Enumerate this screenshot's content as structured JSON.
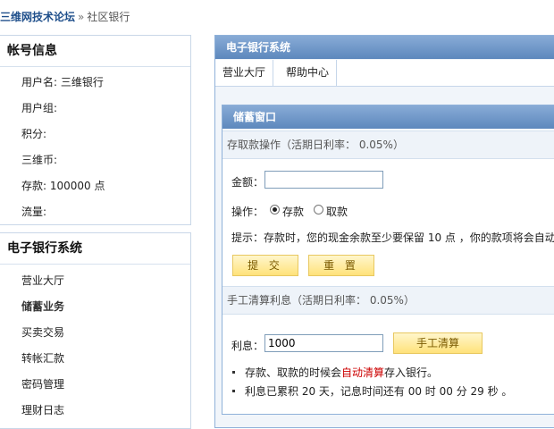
{
  "breadcrumb": {
    "site": "三维网技术论坛",
    "sep": "»",
    "current": "社区银行"
  },
  "account": {
    "title": "帐号信息",
    "rows": [
      {
        "label": "用户名: ",
        "value": "三维银行"
      },
      {
        "label": "用户组:",
        "value": ""
      },
      {
        "label": "积分:",
        "value": ""
      },
      {
        "label": "三维币:",
        "value": ""
      },
      {
        "label": "存款: ",
        "value": "100000 点"
      },
      {
        "label": "流量:",
        "value": ""
      }
    ]
  },
  "bank_nav": {
    "title": "电子银行系统",
    "items": [
      "营业大厅",
      "储蓄业务",
      "买卖交易",
      "转帐汇款",
      "密码管理",
      "理财日志"
    ],
    "active_index": 1
  },
  "main": {
    "title": "电子银行系统",
    "tabs": [
      "营业大厅",
      "帮助中心"
    ],
    "window_title": "储蓄窗口",
    "deposit_section": {
      "title": "存取款操作",
      "rate_text": "（活期日利率：  0.05%）"
    },
    "amount_label": "金额：",
    "amount_value": "",
    "operation_label": "操作：",
    "op_deposit": "存款",
    "op_withdraw": "取款",
    "hint": "提示：存款时，您的现金余款至少要保留  10 点  ，你的款项将会自动",
    "submit_label": "提 交",
    "reset_label": "重 置",
    "interest_section": {
      "title": "手工清算利息",
      "rate_text": "（活期日利率：  0.05%）"
    },
    "interest_label": "利息：",
    "interest_value": "1000",
    "settle_label": "手工清算",
    "note1_a": "存款、取款的时候会",
    "note1_link": "自动清算",
    "note1_b": "存入银行。",
    "note2": "利息已累积  20 天，记息时间还有  00 时  00 分  29 秒  。"
  },
  "colors": {
    "header_blue": "#6f97c6",
    "link_blue": "#1f4f8b",
    "button_yellow": "#ffe27a",
    "alert_red": "#cc0000"
  }
}
